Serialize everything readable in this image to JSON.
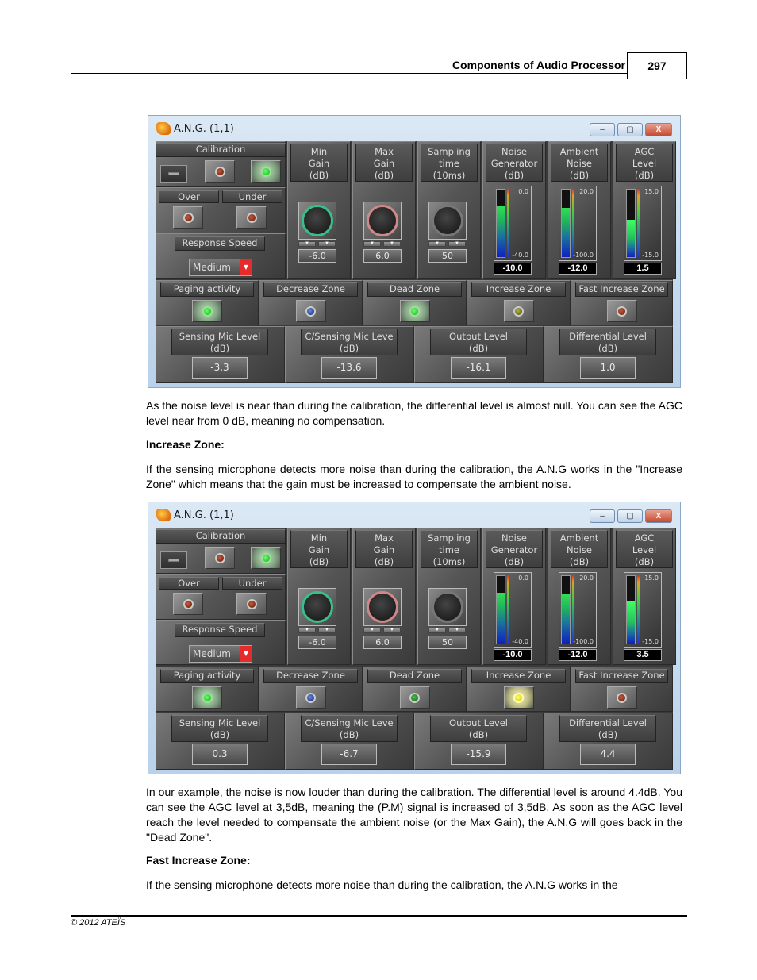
{
  "header": {
    "title": "Components of Audio Processor",
    "page_number": "297"
  },
  "footer": {
    "copyright": "© 2012 ATEÏS"
  },
  "windows": [
    {
      "title": "A.N.G. (1,1)",
      "buttons": {
        "minimize": "–",
        "maximize": "▢",
        "close": "X"
      },
      "calibration": {
        "label": "Calibration",
        "led_left": "red",
        "led_right": "green-on"
      },
      "over": {
        "label": "Over",
        "led": "red"
      },
      "under": {
        "label": "Under",
        "led": "red"
      },
      "response_speed": {
        "label": "Response Speed",
        "value": "Medium"
      },
      "min_gain": {
        "label": [
          "Min",
          "Gain",
          "(dB)"
        ],
        "value": "-6.0"
      },
      "max_gain": {
        "label": [
          "Max",
          "Gain",
          "(dB)"
        ],
        "value": "6.0"
      },
      "sampling_time": {
        "label": [
          "Sampling",
          "time",
          "(10ms)"
        ],
        "value": "50"
      },
      "noise_generator": {
        "label": [
          "Noise",
          "Generator",
          "(dB)"
        ],
        "max": "0.0",
        "min": "-40.0",
        "value": "-10.0",
        "level_fraction": 0.75
      },
      "ambient_noise": {
        "label": [
          "Ambient",
          "Noise",
          "(dB)"
        ],
        "max": "20.0",
        "min": "-100.0",
        "value": "-12.0",
        "level_fraction": 0.73
      },
      "agc_level": {
        "label": [
          "AGC",
          "Level",
          "(dB)"
        ],
        "max": "15.0",
        "min": "-15.0",
        "value": "1.5",
        "level_fraction": 0.55
      },
      "zones": [
        {
          "label": "Paging activity",
          "led": "green",
          "on": true
        },
        {
          "label": "Decrease Zone",
          "led": "blue",
          "on": false
        },
        {
          "label": "Dead Zone",
          "led": "green",
          "on": true
        },
        {
          "label": "Increase Zone",
          "led": "olive",
          "on": false
        },
        {
          "label": "Fast Increase Zone",
          "led": "red",
          "on": false
        }
      ],
      "levels": [
        {
          "label": [
            "Sensing Mic Level",
            "(dB)"
          ],
          "value": "-3.3"
        },
        {
          "label": [
            "C/Sensing Mic Leve",
            "(dB)"
          ],
          "value": "-13.6"
        },
        {
          "label": [
            "Output Level",
            "(dB)"
          ],
          "value": "-16.1"
        },
        {
          "label": [
            "Differential Level",
            "(dB)"
          ],
          "value": "1.0"
        }
      ]
    },
    {
      "title": "A.N.G. (1,1)",
      "buttons": {
        "minimize": "–",
        "maximize": "▢",
        "close": "X"
      },
      "calibration": {
        "label": "Calibration",
        "led_left": "red",
        "led_right": "green-on"
      },
      "over": {
        "label": "Over",
        "led": "red"
      },
      "under": {
        "label": "Under",
        "led": "red"
      },
      "response_speed": {
        "label": "Response Speed",
        "value": "Medium"
      },
      "min_gain": {
        "label": [
          "Min",
          "Gain",
          "(dB)"
        ],
        "value": "-6.0"
      },
      "max_gain": {
        "label": [
          "Max",
          "Gain",
          "(dB)"
        ],
        "value": "6.0"
      },
      "sampling_time": {
        "label": [
          "Sampling",
          "time",
          "(10ms)"
        ],
        "value": "50"
      },
      "noise_generator": {
        "label": [
          "Noise",
          "Generator",
          "(dB)"
        ],
        "max": "0.0",
        "min": "-40.0",
        "value": "-10.0",
        "level_fraction": 0.75
      },
      "ambient_noise": {
        "label": [
          "Ambient",
          "Noise",
          "(dB)"
        ],
        "max": "20.0",
        "min": "-100.0",
        "value": "-12.0",
        "level_fraction": 0.73
      },
      "agc_level": {
        "label": [
          "AGC",
          "Level",
          "(dB)"
        ],
        "max": "15.0",
        "min": "-15.0",
        "value": "3.5",
        "level_fraction": 0.62
      },
      "zones": [
        {
          "label": "Paging activity",
          "led": "green",
          "on": true
        },
        {
          "label": "Decrease Zone",
          "led": "blue",
          "on": false
        },
        {
          "label": "Dead Zone",
          "led": "dkgreen",
          "on": false
        },
        {
          "label": "Increase Zone",
          "led": "yellow",
          "on": true
        },
        {
          "label": "Fast Increase Zone",
          "led": "red",
          "on": false
        }
      ],
      "levels": [
        {
          "label": [
            "Sensing Mic Level",
            "(dB)"
          ],
          "value": "0.3"
        },
        {
          "label": [
            "C/Sensing Mic Leve",
            "(dB)"
          ],
          "value": "-6.7"
        },
        {
          "label": [
            "Output Level",
            "(dB)"
          ],
          "value": "-15.9"
        },
        {
          "label": [
            "Differential Level",
            "(dB)"
          ],
          "value": "4.4"
        }
      ]
    }
  ],
  "text": {
    "p1": "As the noise level is near than during the calibration, the differential level is almost null. You can see the AGC level near from 0 dB, meaning no compensation.",
    "h1": "Increase Zone:",
    "p2": "If the sensing microphone detects more noise than during the calibration, the A.N.G works in the \"Increase Zone\" which means that the gain must be increased to compensate the ambient noise.",
    "p3": "In our example, the noise is now louder than during the calibration. The differential level is around 4.4dB. You can see the AGC level at 3,5dB, meaning the (P.M) signal is increased of 3,5dB. As soon as the AGC level reach the level needed to compensate the ambient noise (or the Max Gain), the A.N.G will goes back in the \"Dead Zone\".",
    "h2": "Fast Increase Zone:",
    "p4": "If the sensing microphone detects more noise than during the calibration, the A.N.G works in the"
  }
}
